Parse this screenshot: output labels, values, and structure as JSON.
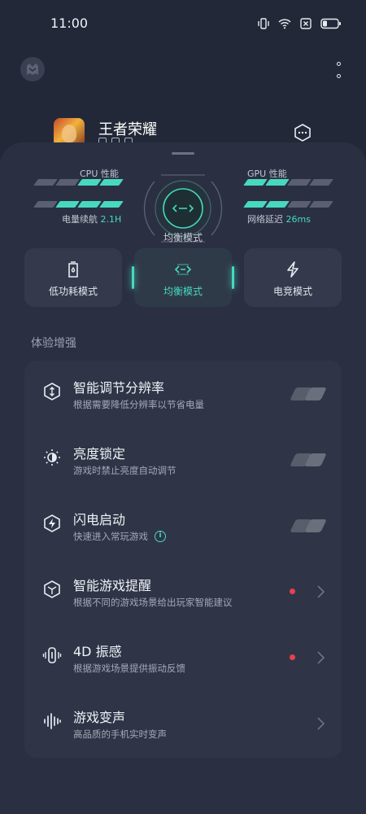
{
  "status_bar": {
    "time": "11:00",
    "icons": [
      "vibrate-icon",
      "wifi-icon",
      "no-sim-icon",
      "battery-icon"
    ]
  },
  "header": {
    "logo_icon": "game-assistant-logo-icon",
    "more_icon": "more-vertical-icon"
  },
  "game": {
    "title": "王者荣耀",
    "icon": "game-app-icon",
    "settings_icon": "hexagon-settings-icon"
  },
  "performance": {
    "cpu_label": "CPU 性能",
    "cpu_level": 2,
    "gpu_label": "GPU 性能",
    "gpu_level": 2,
    "battery_label": "电量续航",
    "battery_value": "2.1H",
    "battery_level": 3,
    "latency_label": "网络延迟",
    "latency_value": "26ms",
    "latency_level": 2,
    "current_mode": "均衡模式",
    "bar_count": 4,
    "accent_color": "#47d9c0"
  },
  "modes": [
    {
      "label": "低功耗模式",
      "icon": "battery-saver-icon",
      "active": false
    },
    {
      "label": "均衡模式",
      "icon": "balance-icon",
      "active": true
    },
    {
      "label": "电竞模式",
      "icon": "lightning-icon",
      "active": false
    }
  ],
  "section": {
    "title": "体验增强"
  },
  "items": [
    {
      "title": "智能调节分辨率",
      "subtitle": "根据需要降低分辨率以节省电量",
      "icon": "resolution-icon",
      "control": "toggle",
      "toggle_on": false
    },
    {
      "title": "亮度锁定",
      "subtitle": "游戏时禁止亮度自动调节",
      "icon": "brightness-icon",
      "control": "toggle",
      "toggle_on": false
    },
    {
      "title": "闪电启动",
      "subtitle": "快速进入常玩游戏",
      "icon": "lightning-hexagon-icon",
      "control": "toggle",
      "toggle_on": false,
      "info": "i"
    },
    {
      "title": "智能游戏提醒",
      "subtitle": "根据不同的游戏场景给出玩家智能建议",
      "icon": "cube-icon",
      "control": "chevron",
      "new_dot": true
    },
    {
      "title": "4D 振感",
      "subtitle": "根据游戏场景提供振动反馈",
      "icon": "vibration-icon",
      "control": "chevron",
      "new_dot": true
    },
    {
      "title": "游戏变声",
      "subtitle": "高品质的手机实时变声",
      "icon": "voice-wave-icon",
      "control": "chevron",
      "new_dot": false
    }
  ]
}
